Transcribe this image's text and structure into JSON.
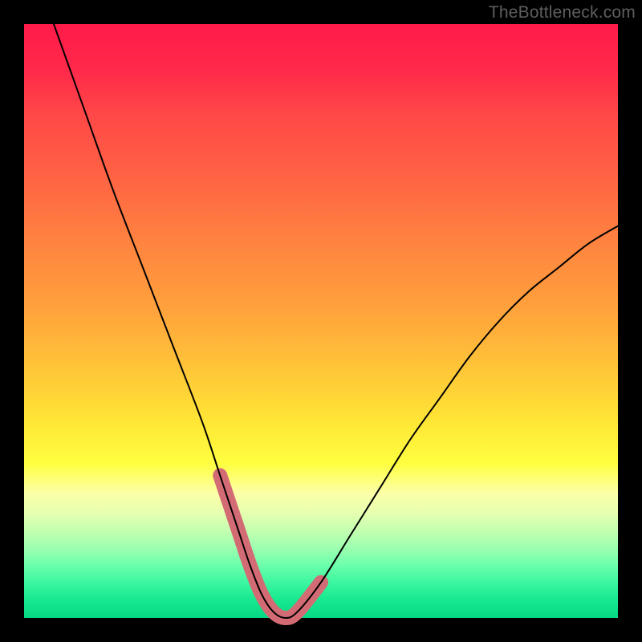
{
  "watermark": "TheBottleneck.com",
  "chart_data": {
    "type": "line",
    "title": "",
    "xlabel": "",
    "ylabel": "",
    "xlim": [
      0,
      100
    ],
    "ylim": [
      0,
      100
    ],
    "series": [
      {
        "name": "bottleneck-curve",
        "x": [
          5,
          10,
          15,
          20,
          25,
          30,
          33,
          36,
          38,
          40,
          42,
          44,
          46,
          50,
          55,
          60,
          65,
          70,
          75,
          80,
          85,
          90,
          95,
          100
        ],
        "values": [
          100,
          86,
          72,
          59,
          46,
          33,
          24,
          15,
          9,
          4,
          1,
          0,
          1,
          6,
          14,
          22,
          30,
          37,
          44,
          50,
          55,
          59,
          63,
          66
        ]
      }
    ],
    "highlight": {
      "name": "bottleneck-highlight",
      "x_range": [
        33,
        50
      ],
      "color": "#d36b74",
      "stroke_width_px": 18
    },
    "gradient_stops": [
      {
        "pos": 0,
        "color": "#ff1a4a"
      },
      {
        "pos": 50,
        "color": "#ffc538"
      },
      {
        "pos": 75,
        "color": "#ffff40"
      },
      {
        "pos": 100,
        "color": "#05d884"
      }
    ]
  }
}
